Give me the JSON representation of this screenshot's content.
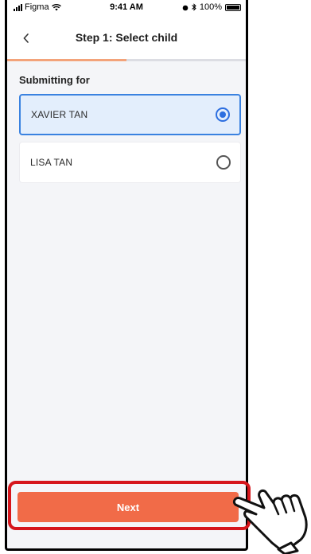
{
  "status_bar": {
    "carrier": "Figma",
    "time": "9:41 AM",
    "battery": "100%"
  },
  "navbar": {
    "back_icon": "chevron-left-icon",
    "title": "Step 1: Select child"
  },
  "progress": {
    "fraction": 0.5,
    "fill_color": "#f3a37a"
  },
  "section": {
    "label": "Submitting for"
  },
  "children": [
    {
      "name": "XAVIER TAN",
      "selected": true
    },
    {
      "name": "LISA TAN",
      "selected": false
    }
  ],
  "footer": {
    "next_label": "Next",
    "button_color": "#f16b48",
    "highlight_color": "#d6161c",
    "pointer_icon": "hand-pointer-icon"
  }
}
